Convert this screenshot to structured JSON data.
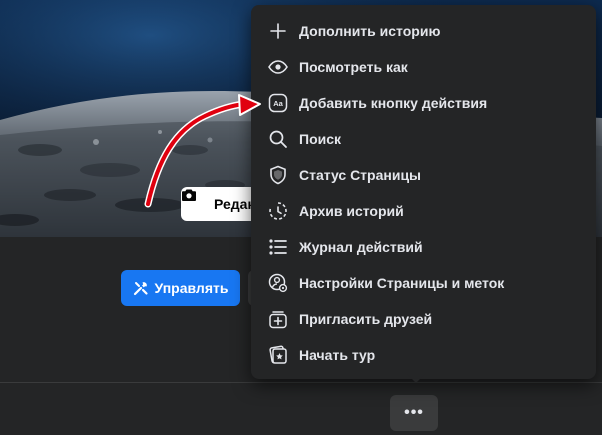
{
  "cover": {
    "edit_label": "Редак",
    "icon": "camera-icon"
  },
  "actions": {
    "manage_label": "Управлять",
    "manage_icon": "wrench-screwdriver-icon",
    "more_label": "•••",
    "more_icon": "more-dots-icon"
  },
  "menu": {
    "items": [
      {
        "label": "Дополнить историю",
        "icon": "plus-icon"
      },
      {
        "label": "Посмотреть как",
        "icon": "eye-icon"
      },
      {
        "label": "Добавить кнопку действия",
        "icon": "action-button-icon"
      },
      {
        "label": "Поиск",
        "icon": "search-icon"
      },
      {
        "label": "Статус Страницы",
        "icon": "shield-icon"
      },
      {
        "label": "Архив историй",
        "icon": "archive-clock-icon"
      },
      {
        "label": "Журнал действий",
        "icon": "list-icon"
      },
      {
        "label": "Настройки Страницы и меток",
        "icon": "profile-gear-icon"
      },
      {
        "label": "Пригласить друзей",
        "icon": "invite-icon"
      },
      {
        "label": "Начать тур",
        "icon": "tour-icon"
      }
    ]
  },
  "colors": {
    "accent": "#1877f2",
    "menu_bg": "#242526",
    "page_bg": "#18191a",
    "annotation_arrow": "#e0000f"
  }
}
